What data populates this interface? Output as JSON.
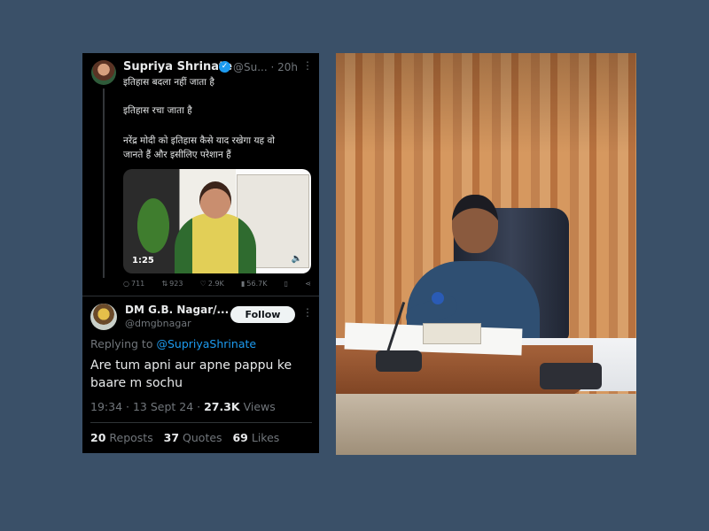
{
  "original_tweet": {
    "author_name": "Supriya Shrinate",
    "handle_time": "@Su... · 20h",
    "lines": [
      "इतिहास बदला नहीं जाता है",
      "इतिहास रचा जाता है",
      "नरेंद्र मोदी को इतिहास कैसे याद रखेगा यह वो",
      "जानते हैं और इसीलिए परेशान हैं"
    ],
    "video_duration": "1:25",
    "replies": "711",
    "retweets": "923",
    "likes": "2.9K",
    "views": "56.7K"
  },
  "reply_tweet": {
    "author_name": "DM G.B. Nagar/...",
    "handle": "@dmgbnagar",
    "follow_label": "Follow",
    "replying_to_label": "Replying to",
    "replying_to_handle": "@SupriyaShrinate",
    "text": "Are tum apni aur apne pappu ke baare m sochu",
    "time": "19:34 · 13 Sept 24 ·",
    "views_count": "27.3K",
    "views_label": "Views",
    "reposts_count": "20",
    "reposts_label": "Reposts",
    "quotes_count": "37",
    "quotes_label": "Quotes",
    "likes_count": "69",
    "likes_label": "Likes"
  },
  "colors": {
    "background": "#3a5068",
    "tweet_background": "#000000",
    "link_blue": "#1d9bf0",
    "muted_text": "#71767b"
  },
  "icons": [
    "more-icon",
    "verified-badge-icon",
    "reply-icon",
    "retweet-icon",
    "like-icon",
    "views-icon",
    "bookmark-icon",
    "share-icon",
    "mute-icon"
  ]
}
